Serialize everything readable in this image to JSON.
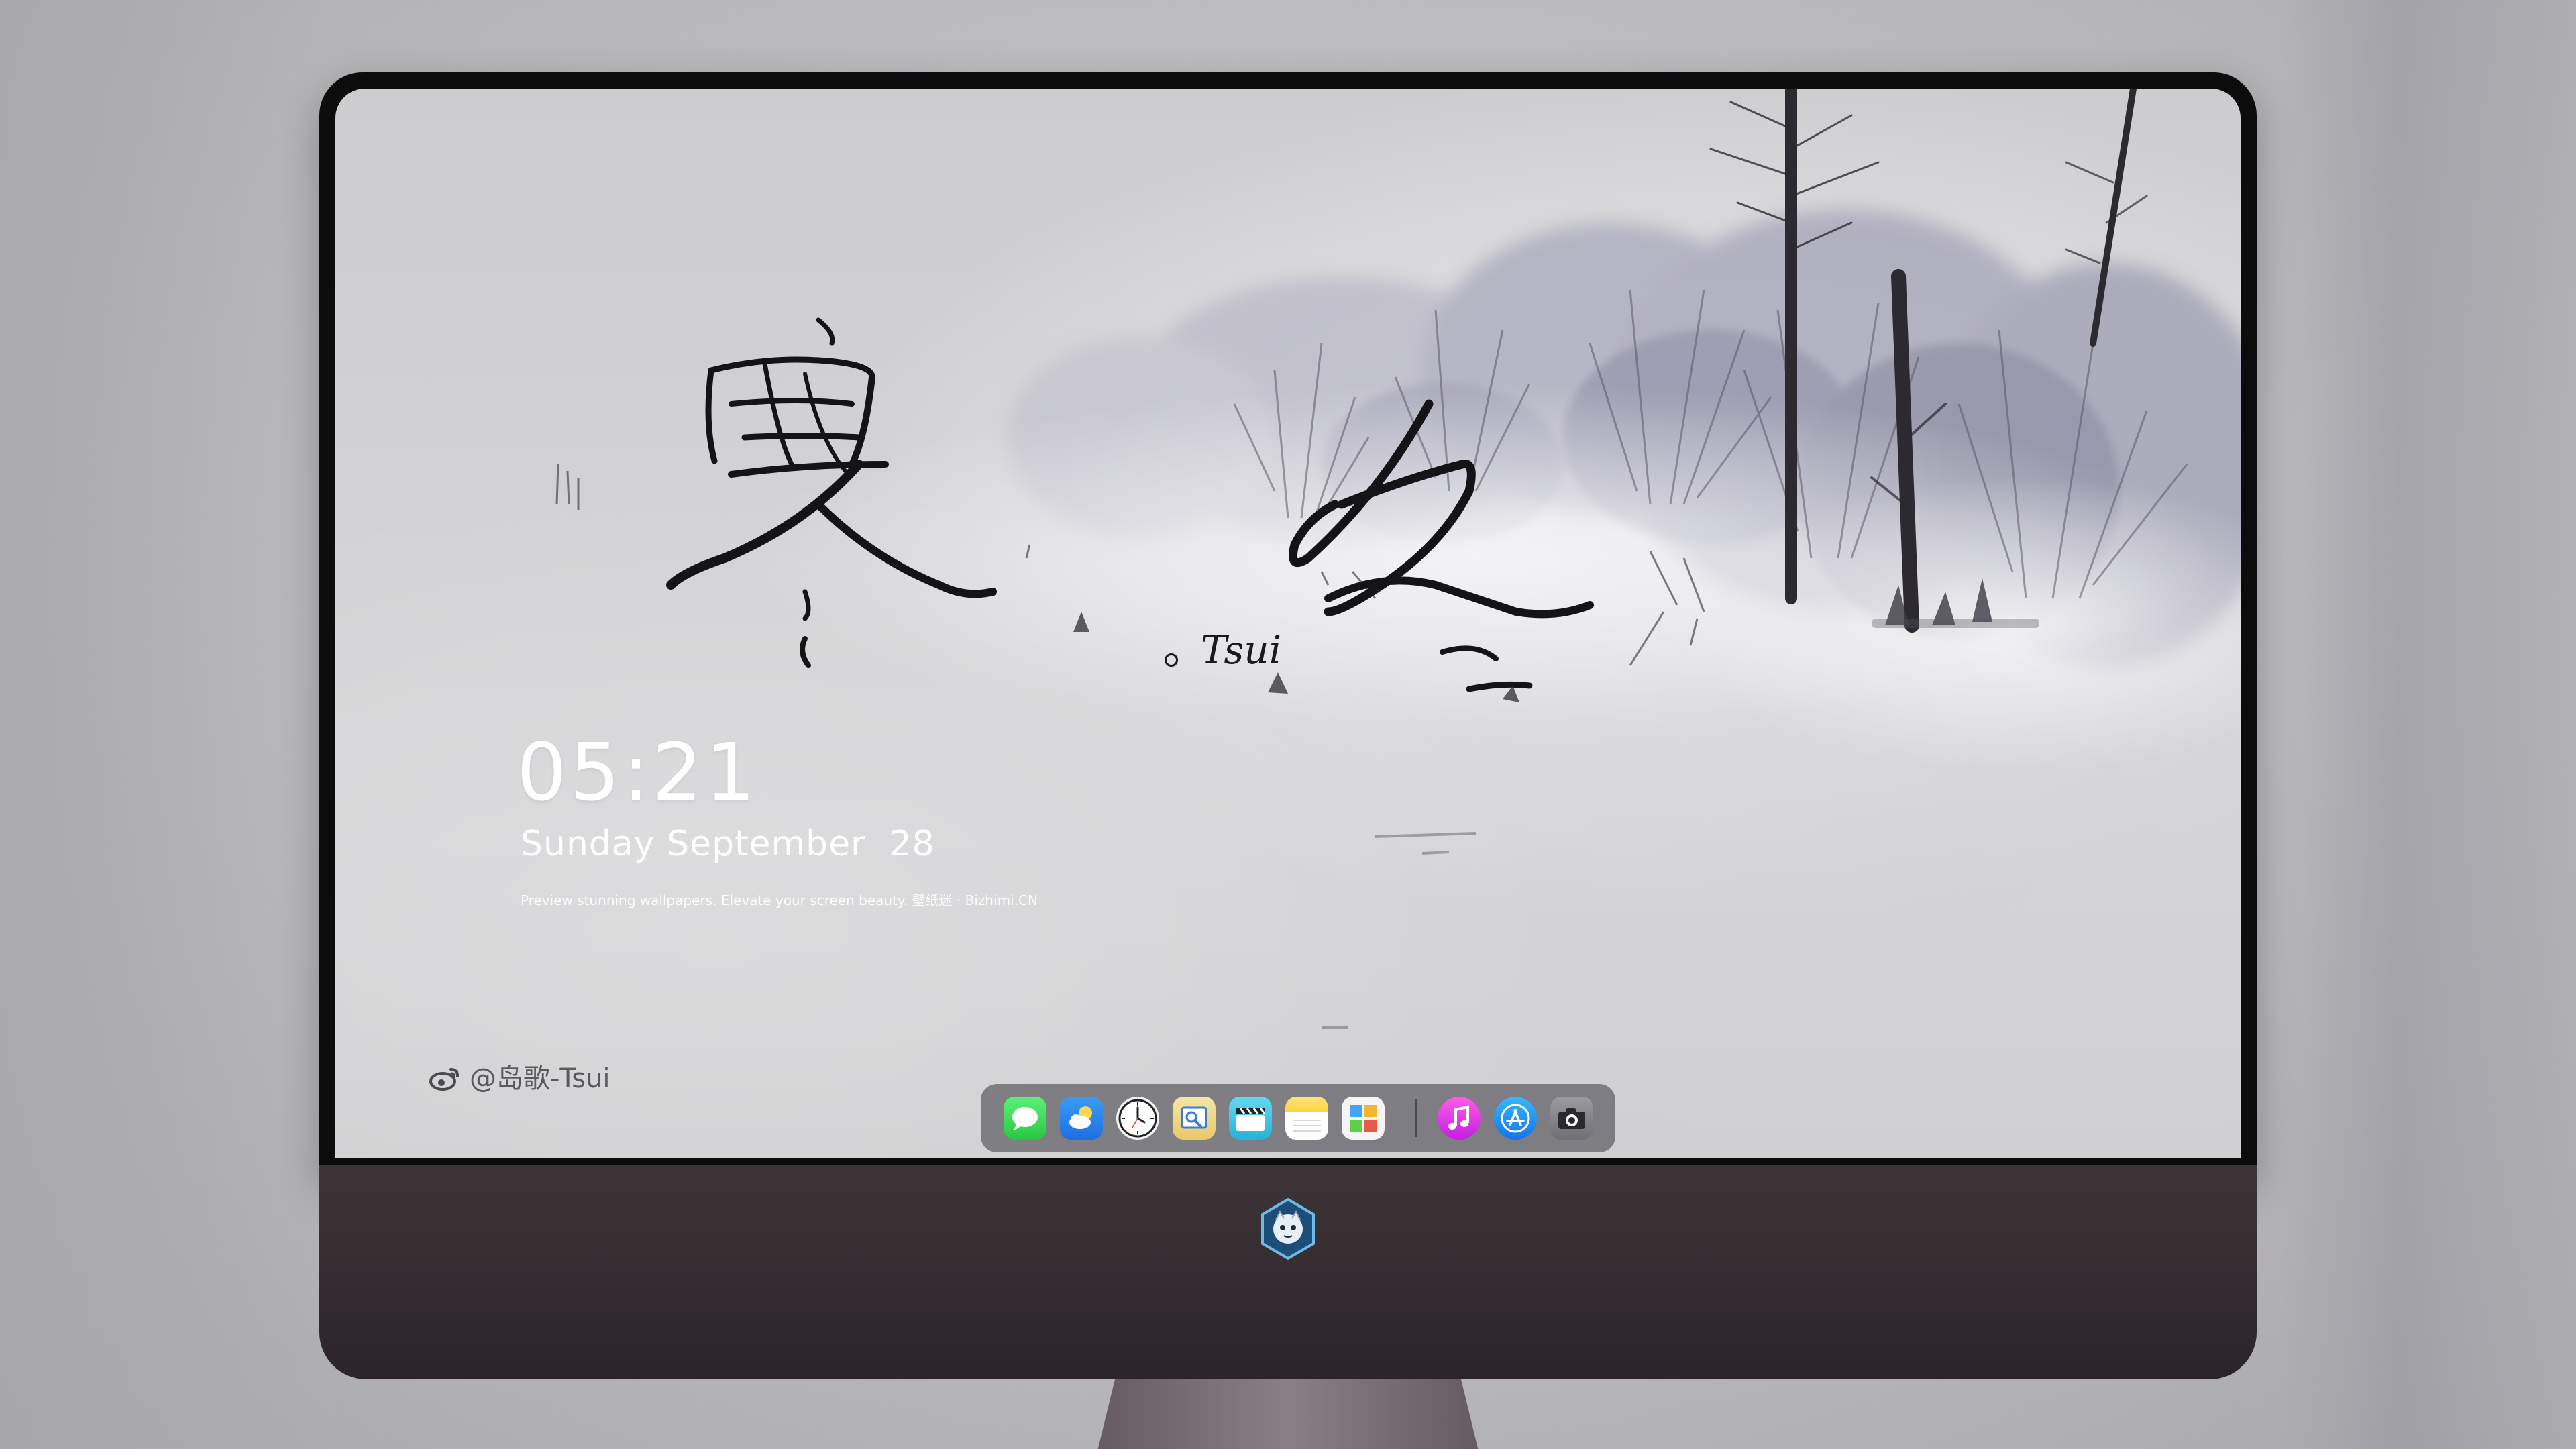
{
  "lockscreen": {
    "time": "05:21",
    "date": "Sunday September  28",
    "tagline": "Preview stunning wallpapers. Elevate your screen beauty. 壁纸迷 · Bizhimi.CN",
    "handle": "@岛歌-Tsui",
    "signature": "Tsui"
  },
  "wallpaper": {
    "calligraphy": "寒冬",
    "theme": "winter ink landscape"
  },
  "dock": {
    "items": [
      {
        "name": "messages",
        "icon": "speech-bubble-icon",
        "color": "#27c83f"
      },
      {
        "name": "weather",
        "icon": "cloud-sun-icon",
        "color": "#1f6fe0"
      },
      {
        "name": "clock",
        "icon": "clock-icon",
        "color": "#f2f2f2"
      },
      {
        "name": "preview",
        "icon": "preview-icon",
        "color": "#e9c96a"
      },
      {
        "name": "clips",
        "icon": "clapperboard-icon",
        "color": "#25b2dc"
      },
      {
        "name": "notes",
        "icon": "notes-icon",
        "color": "#ffd23f"
      },
      {
        "name": "photos",
        "icon": "photos-icon",
        "color": "#f5f5f5"
      },
      {
        "name": "music",
        "icon": "music-note-icon",
        "color": "#c41fe0"
      },
      {
        "name": "app-store",
        "icon": "app-store-icon",
        "color": "#1574ec"
      },
      {
        "name": "camera",
        "icon": "camera-icon",
        "color": "#6f6f75"
      }
    ]
  },
  "colors": {
    "monitor_bezel": "#0c0c0d",
    "monitor_chin": "#332b2f",
    "background": "#bdbcbf",
    "clock_text": "#ffffff",
    "ink": "#1a1a1c"
  }
}
